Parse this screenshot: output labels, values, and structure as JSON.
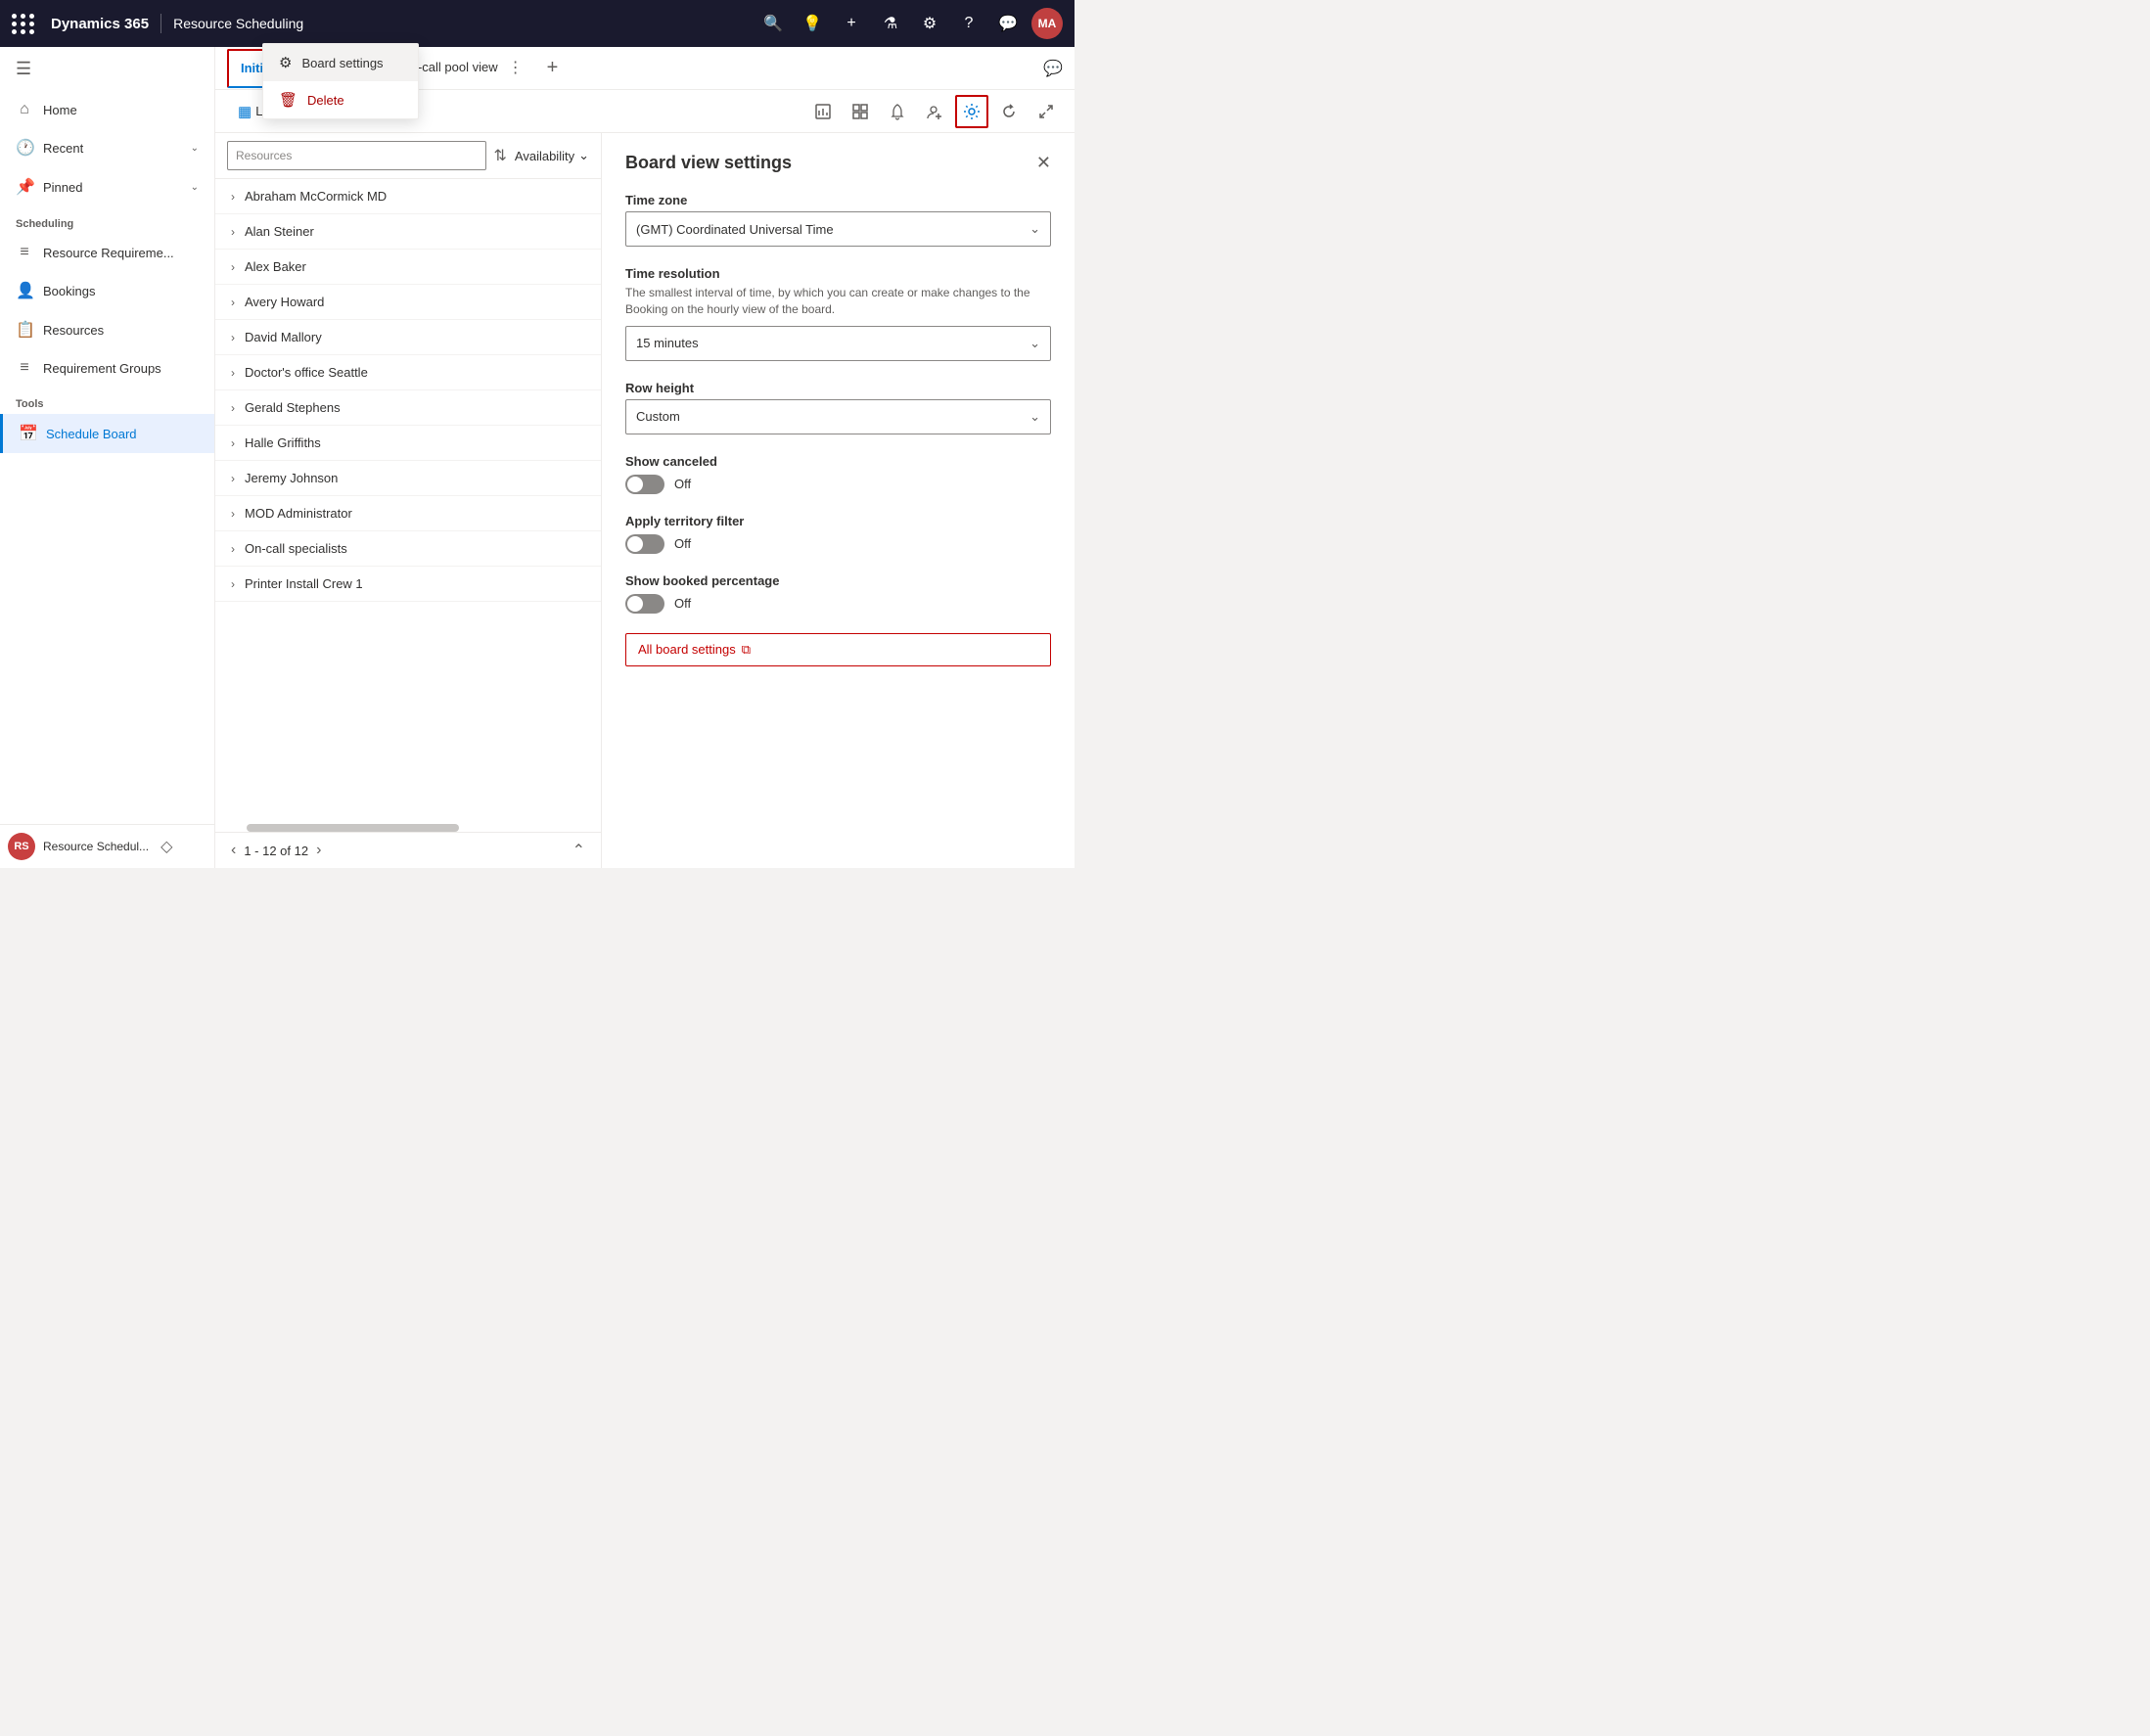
{
  "topNav": {
    "brandName": "Dynamics 365",
    "moduleName": "Resource Scheduling",
    "avatarInitials": "MA",
    "avatarBg": "#c04040"
  },
  "sidebar": {
    "hamburgerIcon": "☰",
    "navItems": [
      {
        "id": "home",
        "label": "Home",
        "icon": "⌂",
        "hasChevron": false
      },
      {
        "id": "recent",
        "label": "Recent",
        "icon": "🕐",
        "hasChevron": true
      },
      {
        "id": "pinned",
        "label": "Pinned",
        "icon": "📌",
        "hasChevron": true
      }
    ],
    "schedulingLabel": "Scheduling",
    "schedulingItems": [
      {
        "id": "resource-req",
        "label": "Resource Requireme...",
        "icon": "≡"
      },
      {
        "id": "bookings",
        "label": "Bookings",
        "icon": "👤"
      },
      {
        "id": "resources",
        "label": "Resources",
        "icon": "📋"
      },
      {
        "id": "req-groups",
        "label": "Requirement Groups",
        "icon": "≡"
      }
    ],
    "toolsLabel": "Tools",
    "toolsItems": [
      {
        "id": "schedule-board",
        "label": "Schedule Board",
        "icon": "📅",
        "active": true
      }
    ],
    "bottomText": "Resource Schedul...",
    "bottomAvatarInitials": "RS",
    "diamondIcon": "◇"
  },
  "tabs": [
    {
      "id": "initial-public",
      "label": "Initial public view",
      "active": true,
      "hasOptions": true
    },
    {
      "id": "on-call-pool",
      "label": "On-call pool view",
      "active": false,
      "hasOptions": true
    }
  ],
  "toolbar": {
    "listLabel": "List",
    "listIcon": "▦",
    "moreIcon": "···",
    "rightIcons": [
      {
        "id": "report",
        "icon": "📊",
        "highlighted": false
      },
      {
        "id": "grid",
        "icon": "▤",
        "highlighted": false
      },
      {
        "id": "bell",
        "icon": "🔔",
        "highlighted": false
      },
      {
        "id": "person",
        "icon": "👤",
        "highlighted": false
      },
      {
        "id": "settings",
        "icon": "⚙",
        "highlighted": true
      },
      {
        "id": "refresh",
        "icon": "↻",
        "highlighted": false
      },
      {
        "id": "expand",
        "icon": "⤢",
        "highlighted": false
      }
    ]
  },
  "resourceList": {
    "searchPlaceholder": "Resources",
    "filterLabel": "Availability",
    "filterIcon": "⌄",
    "sortIcon": "⇅",
    "items": [
      {
        "name": "Abraham McCormick MD"
      },
      {
        "name": "Alan Steiner"
      },
      {
        "name": "Alex Baker"
      },
      {
        "name": "Avery Howard"
      },
      {
        "name": "David Mallory"
      },
      {
        "name": "Doctor's office Seattle"
      },
      {
        "name": "Gerald Stephens"
      },
      {
        "name": "Halle Griffiths"
      },
      {
        "name": "Jeremy Johnson"
      },
      {
        "name": "MOD Administrator"
      },
      {
        "name": "On-call specialists"
      },
      {
        "name": "Printer Install Crew 1"
      }
    ],
    "pagination": "1 - 12 of 12"
  },
  "contextMenu": {
    "items": [
      {
        "id": "board-settings",
        "label": "Board settings",
        "icon": "⚙",
        "highlighted": true
      },
      {
        "id": "delete",
        "label": "Delete",
        "icon": "🗑",
        "isDelete": true
      }
    ]
  },
  "boardViewSettings": {
    "title": "Board view settings",
    "closeIcon": "✕",
    "sections": [
      {
        "id": "timezone",
        "label": "Time zone",
        "type": "select",
        "value": "(GMT) Coordinated Universal Time"
      },
      {
        "id": "timeResolution",
        "label": "Time resolution",
        "description": "The smallest interval of time, by which you can create or make changes to the Booking on the hourly view of the board.",
        "type": "select",
        "value": "15 minutes"
      },
      {
        "id": "rowHeight",
        "label": "Row height",
        "type": "select",
        "value": "Custom"
      },
      {
        "id": "showCanceled",
        "label": "Show canceled",
        "type": "toggle",
        "toggleValue": false,
        "toggleLabel": "Off"
      },
      {
        "id": "applyTerritoryFilter",
        "label": "Apply territory filter",
        "type": "toggle",
        "toggleValue": false,
        "toggleLabel": "Off"
      },
      {
        "id": "showBookedPercentage",
        "label": "Show booked percentage",
        "type": "toggle",
        "toggleValue": false,
        "toggleLabel": "Off"
      }
    ],
    "allBoardSettingsLabel": "All board settings",
    "allBoardSettingsIcon": "⧉"
  }
}
